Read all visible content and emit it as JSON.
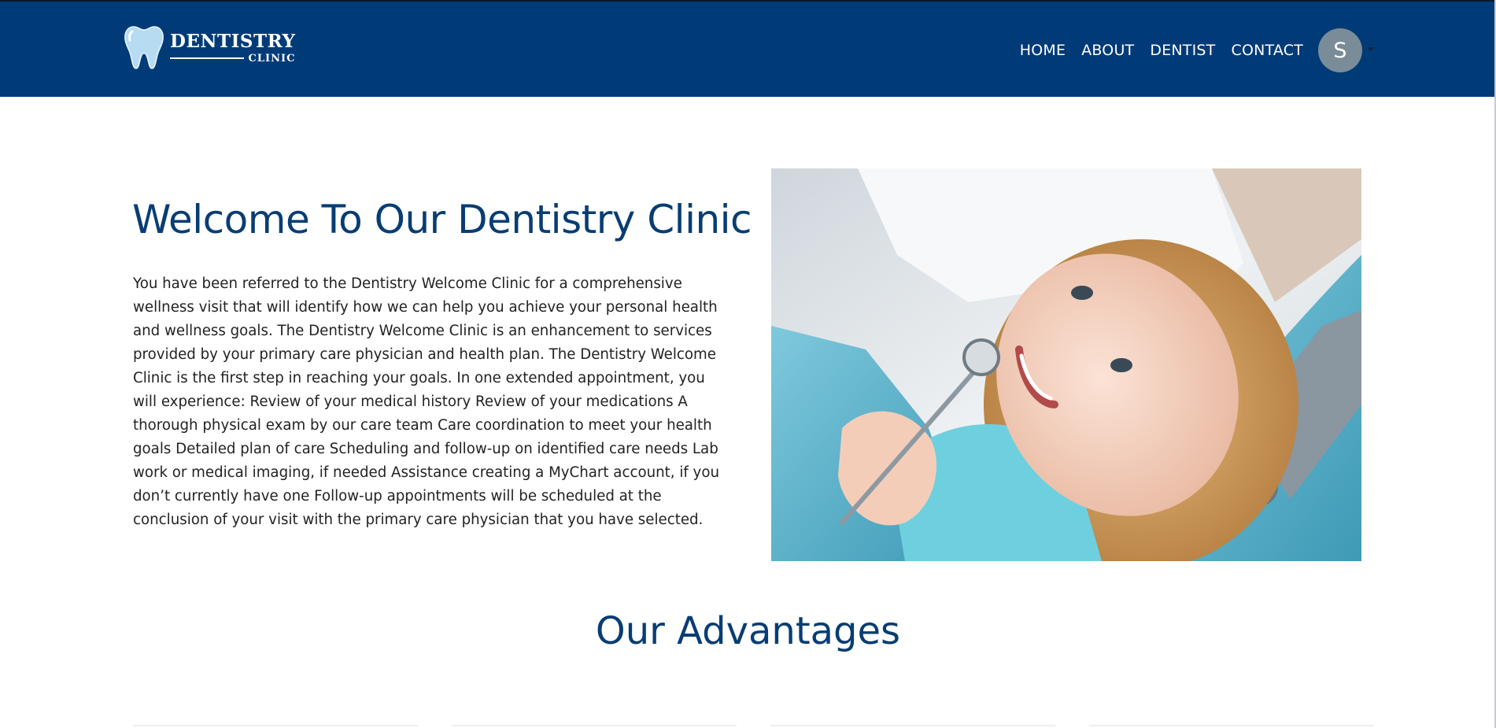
{
  "brand": {
    "name": "DENTISTRY",
    "sub": "CLINIC",
    "logo_icon": "tooth-icon"
  },
  "nav": {
    "items": [
      {
        "label": "HOME"
      },
      {
        "label": "ABOUT"
      },
      {
        "label": "DENTIST"
      },
      {
        "label": "CONTACT"
      }
    ],
    "avatar_initial": "S"
  },
  "hero": {
    "title": "Welcome To Our Dentistry Clinic",
    "body": "You have been referred to the Dentistry Welcome Clinic for a comprehensive wellness visit that will identify how we can help you achieve your personal health and wellness goals. The Dentistry Welcome Clinic is an enhancement to services provided by your primary care physician and health plan. The Dentistry Welcome Clinic is the first step in reaching your goals. In one extended appointment, you will experience: Review of your medical history Review of your medications A thorough physical exam by our care team Care coordination to meet your health goals Detailed plan of care Scheduling and follow-up on identified care needs Lab work or medical imaging, if needed Assistance creating a MyChart account, if you don’t currently have one Follow-up appointments will be scheduled at the conclusion of your visit with the primary care physician that you have selected."
  },
  "advantages": {
    "title": "Our Advantages"
  },
  "colors": {
    "navbar": "#013b77",
    "heading": "#083d73",
    "avatar": "#7a8c98"
  }
}
